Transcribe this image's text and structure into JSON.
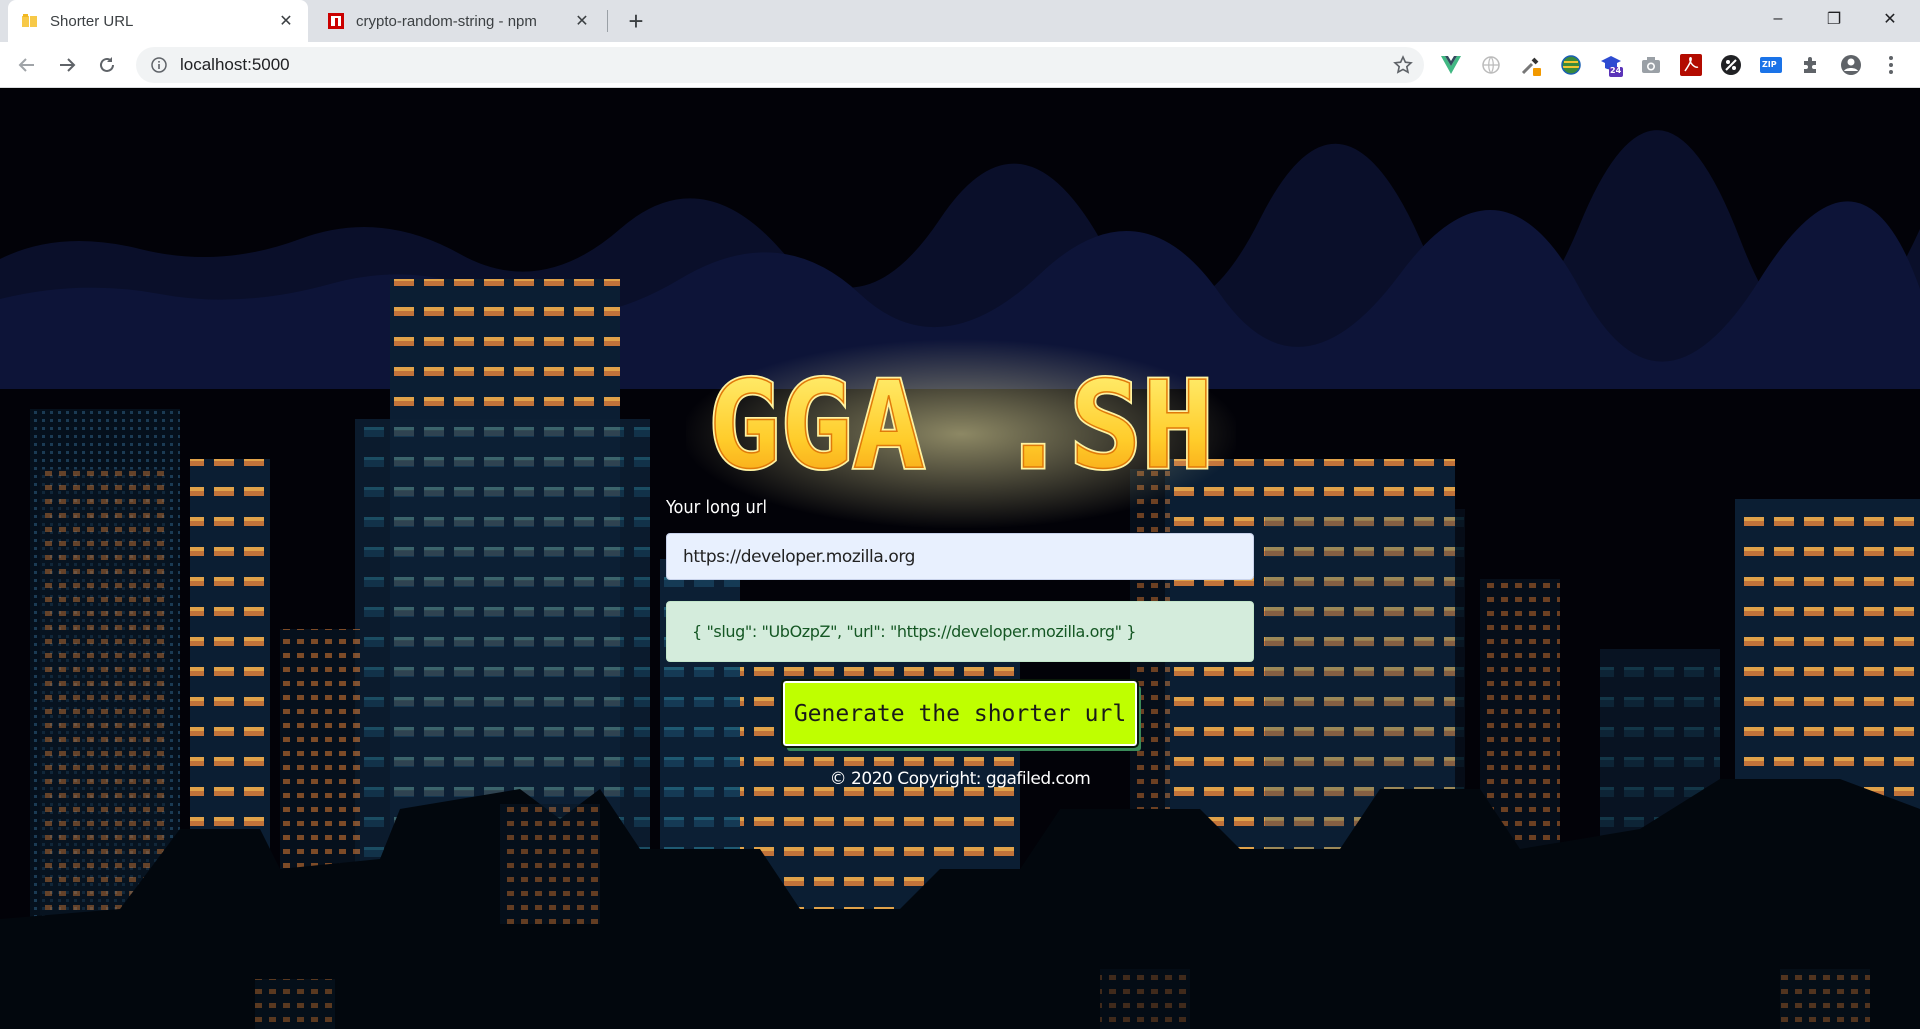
{
  "browser": {
    "tabs": [
      {
        "title": "Shorter URL",
        "close": "✕"
      },
      {
        "title": "crypto-random-string - npm",
        "close": "✕"
      }
    ],
    "new_tab": "+",
    "window_controls": {
      "minimize": "–",
      "maximize": "❐",
      "close": "✕"
    },
    "address": "localhost:5000",
    "extension_badges": {
      "calendar": "24",
      "zip": "ZIP"
    }
  },
  "page": {
    "logo_text": "GGA .SH",
    "label": "Your long url",
    "input_value": "https://developer.mozilla.org",
    "result_text": "{ \"slug\": \"UbOzpZ\", \"url\": \"https://developer.mozilla.org\" }",
    "button_label": "Generate the shorter url",
    "copyright": "© 2020 Copyright: ggafiled.com"
  },
  "colors": {
    "button_bg": "#bfff00",
    "result_bg": "#d4ecdc",
    "result_text": "#155724",
    "input_bg": "#e8f0fe",
    "logo_fill": "#ffd84a",
    "logo_glow": "#fff3a0"
  }
}
